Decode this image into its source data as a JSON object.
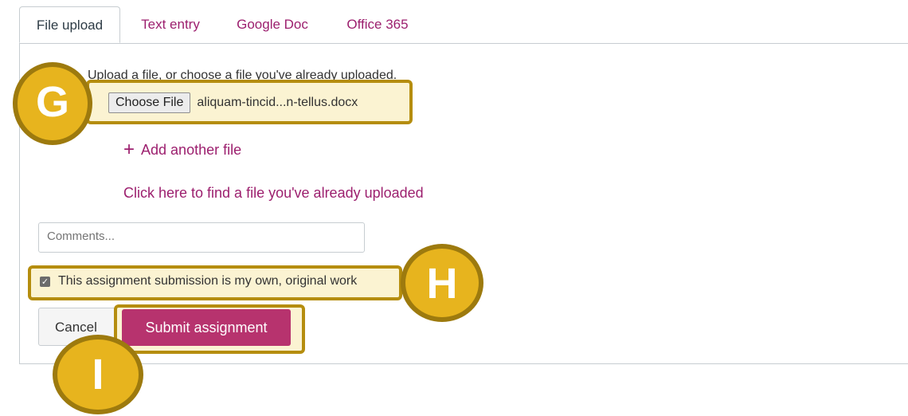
{
  "tabs": [
    {
      "label": "File upload",
      "active": true
    },
    {
      "label": "Text entry",
      "active": false
    },
    {
      "label": "Google Doc",
      "active": false
    },
    {
      "label": "Office 365",
      "active": false
    }
  ],
  "upload": {
    "instructions": "Upload a file, or choose a file you've already uploaded.",
    "choose_file_label": "Choose File",
    "file_name": "aliquam-tincid...n-tellus.docx",
    "add_another_file": "Add another file",
    "find_uploaded": "Click here to find a file you've already uploaded"
  },
  "comments": {
    "placeholder": "Comments..."
  },
  "agreement": {
    "label": "This assignment submission is my own, original work",
    "checked": true
  },
  "actions": {
    "cancel_label": "Cancel",
    "submit_label": "Submit assignment"
  },
  "callouts": {
    "g": "G",
    "h": "H",
    "i": "I"
  },
  "colors": {
    "link": "#9c1f6e",
    "submit": "#b7336e",
    "callout": "#e7b41e",
    "callout_border": "#9d7a0e",
    "highlight": "#fbf3d2"
  }
}
